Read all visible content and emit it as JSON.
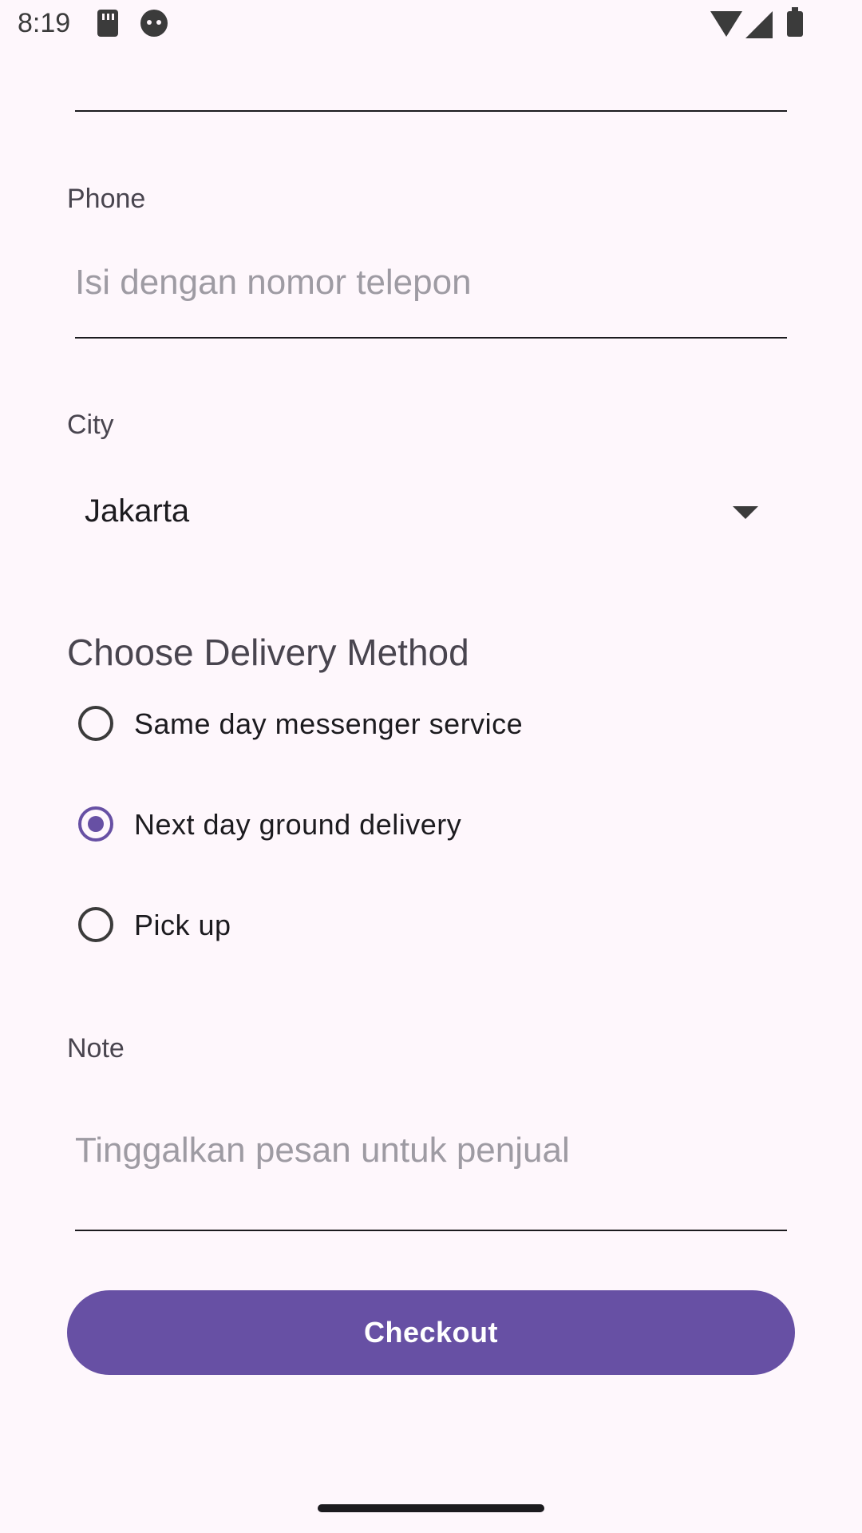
{
  "status_bar": {
    "time": "8:19",
    "icons": [
      "sd-card-icon",
      "face-icon",
      "wifi-icon",
      "signal-icon",
      "battery-icon"
    ]
  },
  "form": {
    "phone": {
      "label": "Phone",
      "placeholder": "Isi dengan nomor telepon",
      "value": ""
    },
    "city": {
      "label": "City",
      "selected": "Jakarta"
    },
    "delivery": {
      "title": "Choose Delivery Method",
      "options": [
        {
          "label": "Same day messenger service",
          "checked": false
        },
        {
          "label": "Next day ground delivery",
          "checked": true
        },
        {
          "label": "Pick up",
          "checked": false
        }
      ]
    },
    "note": {
      "label": "Note",
      "placeholder": "Tinggalkan pesan untuk penjual",
      "value": ""
    },
    "checkout_label": "Checkout"
  },
  "colors": {
    "background": "#FEF7FC",
    "primary": "#6750A4",
    "text": "#1C1B1F",
    "placeholder": "#9E9BA3"
  }
}
